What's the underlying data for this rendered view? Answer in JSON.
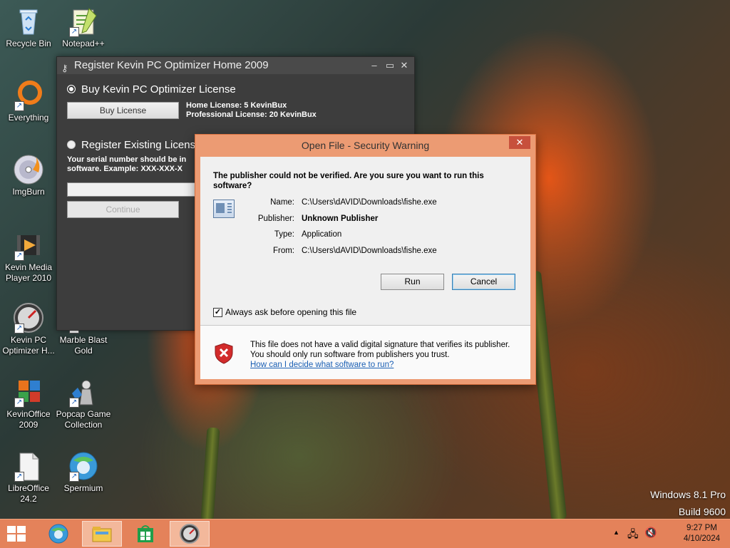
{
  "desktop": {
    "icons": [
      {
        "label": "Recycle Bin",
        "icon": "recycle-bin-icon"
      },
      {
        "label": "Notepad++",
        "icon": "notepadpp-icon"
      },
      {
        "label": "Everything",
        "icon": "everything-icon"
      },
      {
        "label": "ImgBurn",
        "icon": "imgburn-icon"
      },
      {
        "label": "Kevin Media Player 2010",
        "icon": "media-player-icon"
      },
      {
        "label": "Kevin PC Optimizer H...",
        "icon": "optimizer-icon"
      },
      {
        "label": "Marble Blast Gold",
        "icon": "marble-blast-icon"
      },
      {
        "label": "KevinOffice 2009",
        "icon": "office-icon"
      },
      {
        "label": "Popcap Game Collection",
        "icon": "popcap-icon"
      },
      {
        "label": "LibreOffice 24.2",
        "icon": "libreoffice-icon"
      },
      {
        "label": "Spermium",
        "icon": "browser-icon"
      }
    ],
    "watermark": {
      "line1": "Windows 8.1 Pro",
      "line2": "Build 9600"
    }
  },
  "register_window": {
    "title": "Register Kevin PC Optimizer Home 2009",
    "option_buy": "Buy Kevin PC Optimizer License",
    "buy_button": "Buy License",
    "home_license": "Home License: 5 KevinBux",
    "pro_license": "Professional License: 20 KevinBux",
    "option_register": "Register Existing License",
    "serial_hint_1": "Your serial number should be in",
    "serial_hint_2": "software. Example: XXX-XXX-X",
    "continue_button": "Continue"
  },
  "security_dialog": {
    "title": "Open File - Security Warning",
    "close": "✕",
    "question": "The publisher could not be verified.  Are you sure you want to run this software?",
    "fields": [
      {
        "label": "Name:",
        "value": "C:\\Users\\dAVID\\Downloads\\fishe.exe",
        "bold": false
      },
      {
        "label": "Publisher:",
        "value": "Unknown Publisher",
        "bold": true
      },
      {
        "label": "Type:",
        "value": "Application",
        "bold": false
      },
      {
        "label": "From:",
        "value": "C:\\Users\\dAVID\\Downloads\\fishe.exe",
        "bold": false
      }
    ],
    "run_button": "Run",
    "cancel_button": "Cancel",
    "checkbox_label": "Always ask before opening this file",
    "checkbox_checked": true,
    "warning_text": "This file does not have a valid digital signature that verifies its publisher.  You should only run software from publishers you trust.",
    "help_link": "How can I decide what software to run?"
  },
  "taskbar": {
    "items": [
      {
        "icon": "start-icon"
      },
      {
        "icon": "browser-icon"
      },
      {
        "icon": "file-explorer-icon",
        "active": true
      },
      {
        "icon": "store-icon"
      },
      {
        "icon": "optimizer-icon",
        "active": true
      }
    ],
    "time": "9:27 PM",
    "date": "4/10/2024"
  },
  "colors": {
    "accent": "#e4825a",
    "dialog_border": "#ec9b73",
    "link": "#1a5fb4"
  }
}
